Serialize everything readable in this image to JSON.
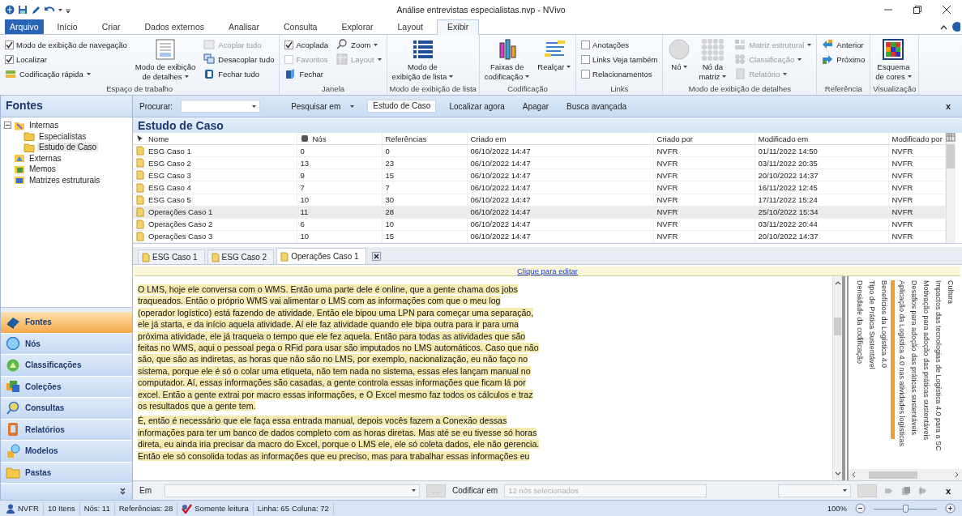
{
  "window": {
    "title": "Análise entrevistas especialistas.nvp - NVivo"
  },
  "ribbon_tabs": [
    {
      "label": "Arquivo",
      "kind": "file",
      "selected": false
    },
    {
      "label": "Início",
      "kind": "tab",
      "selected": false
    },
    {
      "label": "Criar",
      "kind": "tab",
      "selected": false
    },
    {
      "label": "Dados externos",
      "kind": "tab",
      "selected": false
    },
    {
      "label": "Analisar",
      "kind": "tab",
      "selected": false
    },
    {
      "label": "Consulta",
      "kind": "tab",
      "selected": false
    },
    {
      "label": "Explorar",
      "kind": "tab",
      "selected": false
    },
    {
      "label": "Layout",
      "kind": "tab",
      "selected": false
    },
    {
      "label": "Exibir",
      "kind": "tab",
      "selected": true
    }
  ],
  "ribbon_groups": [
    {
      "label": "Espaço de trabalho",
      "columns": [
        [
          {
            "kind": "check",
            "label": "Modo de exibição de navegação",
            "checked": true,
            "disabled": false
          },
          {
            "kind": "check",
            "label": "Localizar",
            "checked": true,
            "disabled": false
          },
          {
            "kind": "small",
            "label": "Codificação rápida",
            "disabled": false,
            "dropdown": true
          }
        ],
        [
          {
            "kind": "large",
            "label": "Modo de exibição\nde detalhes",
            "disabled": false,
            "dropdown": true
          }
        ],
        [
          {
            "kind": "small",
            "label": "Acoplar tudo",
            "disabled": true,
            "dropdown": false
          },
          {
            "kind": "small",
            "label": "Desacoplar tudo",
            "disabled": false,
            "dropdown": false
          },
          {
            "kind": "small",
            "label": "Fechar tudo",
            "disabled": false,
            "dropdown": false
          }
        ]
      ]
    },
    {
      "label": "Janela",
      "columns": [
        [
          {
            "kind": "check",
            "label": "Acoplada",
            "checked": true,
            "disabled": false
          },
          {
            "kind": "check",
            "label": "Favoritos",
            "checked": false,
            "disabled": true
          },
          {
            "kind": "small",
            "label": "Fechar",
            "disabled": false,
            "dropdown": false
          }
        ],
        [
          {
            "kind": "small",
            "label": "Zoom",
            "disabled": false,
            "dropdown": true
          },
          {
            "kind": "small",
            "label": "Layout",
            "disabled": true,
            "dropdown": true
          }
        ]
      ]
    },
    {
      "label": "Modo de exibição de lista",
      "columns": [
        [
          {
            "kind": "large",
            "label": "Modo de\nexibição de lista",
            "disabled": false,
            "dropdown": true
          }
        ]
      ]
    },
    {
      "label": "Codificação",
      "columns": [
        [
          {
            "kind": "large",
            "label": "Faixas de\ncodificação",
            "disabled": false,
            "dropdown": true
          }
        ],
        [
          {
            "kind": "large",
            "label": "Realçar",
            "disabled": false,
            "dropdown": true
          }
        ]
      ]
    },
    {
      "label": "Links",
      "columns": [
        [
          {
            "kind": "check",
            "label": "Anotações",
            "checked": false,
            "disabled": false
          },
          {
            "kind": "check",
            "label": "Links Veja também",
            "checked": false,
            "disabled": false
          },
          {
            "kind": "check",
            "label": "Relacionamentos",
            "checked": false,
            "disabled": false
          }
        ]
      ]
    },
    {
      "label": "Modo de exibição de detalhes",
      "columns": [
        [
          {
            "kind": "large",
            "label": "Nó",
            "disabled": true,
            "dropdown": true
          }
        ],
        [
          {
            "kind": "large",
            "label": "Nó da\nmatriz",
            "disabled": true,
            "dropdown": true
          }
        ],
        [
          {
            "kind": "small",
            "label": "Matriz estrutural",
            "disabled": true,
            "dropdown": true
          },
          {
            "kind": "small",
            "label": "Classificação",
            "disabled": true,
            "dropdown": true
          },
          {
            "kind": "small",
            "label": "Relatório",
            "disabled": true,
            "dropdown": true
          }
        ]
      ]
    },
    {
      "label": "Referência",
      "columns": [
        [
          {
            "kind": "small",
            "label": "Anterior",
            "disabled": false,
            "dropdown": false
          },
          {
            "kind": "small",
            "label": "Próximo",
            "disabled": false,
            "dropdown": false
          }
        ]
      ]
    },
    {
      "label": "Visualização",
      "columns": [
        [
          {
            "kind": "large",
            "label": "Esquema\nde cores",
            "disabled": false,
            "dropdown": true
          }
        ]
      ]
    }
  ],
  "sidebar": {
    "title": "Fontes",
    "tree": [
      {
        "label": "Internas",
        "expanded": true,
        "selected": false,
        "children": [
          {
            "label": "Especialistas",
            "selected": false
          },
          {
            "label": "Estudo de Caso",
            "selected": true
          }
        ]
      },
      {
        "label": "Externas",
        "selected": false
      },
      {
        "label": "Memos",
        "selected": false
      },
      {
        "label": "Matrizes estruturais",
        "selected": false
      }
    ],
    "nav": [
      {
        "label": "Fontes",
        "selected": true
      },
      {
        "label": "Nós",
        "selected": false
      },
      {
        "label": "Classificações",
        "selected": false
      },
      {
        "label": "Coleções",
        "selected": false
      },
      {
        "label": "Consultas",
        "selected": false
      },
      {
        "label": "Relatórios",
        "selected": false
      },
      {
        "label": "Modelos",
        "selected": false
      },
      {
        "label": "Pastas",
        "selected": false
      }
    ]
  },
  "find_bar": {
    "label": "Procurar:",
    "search_in_label": "Pesquisar em",
    "search_in_value": "Estudo de Caso",
    "find_now": "Localizar agora",
    "clear": "Apagar",
    "advanced": "Busca avançada",
    "close": "x"
  },
  "list": {
    "title": "Estudo de Caso",
    "columns": [
      "Nome",
      "Nós",
      "Referências",
      "Criado em",
      "Criado por",
      "Modificado em",
      "Modificado por"
    ],
    "rows": [
      {
        "selected": false,
        "cells": [
          "ESG Caso 1",
          "0",
          "0",
          "06/10/2022 14:47",
          "NVFR",
          "01/11/2022 14:50",
          "NVFR"
        ]
      },
      {
        "selected": false,
        "cells": [
          "ESG Caso 2",
          "13",
          "23",
          "06/10/2022 14:47",
          "NVFR",
          "03/11/2022 20:35",
          "NVFR"
        ]
      },
      {
        "selected": false,
        "cells": [
          "ESG Caso 3",
          "9",
          "15",
          "06/10/2022 14:47",
          "NVFR",
          "20/10/2022 14:37",
          "NVFR"
        ]
      },
      {
        "selected": false,
        "cells": [
          "ESG Caso 4",
          "7",
          "7",
          "06/10/2022 14:47",
          "NVFR",
          "16/11/2022 12:45",
          "NVFR"
        ]
      },
      {
        "selected": false,
        "cells": [
          "ESG Caso 5",
          "10",
          "30",
          "06/10/2022 14:47",
          "NVFR",
          "17/11/2022 15:24",
          "NVFR"
        ]
      },
      {
        "selected": true,
        "cells": [
          "Operações Caso 1",
          "11",
          "28",
          "06/10/2022 14:47",
          "NVFR",
          "25/10/2022 15:34",
          "NVFR"
        ]
      },
      {
        "selected": false,
        "cells": [
          "Operações Caso 2",
          "6",
          "10",
          "06/10/2022 14:47",
          "NVFR",
          "03/11/2022 20:44",
          "NVFR"
        ]
      },
      {
        "selected": false,
        "cells": [
          "Operações Caso 3",
          "10",
          "15",
          "06/10/2022 14:47",
          "NVFR",
          "20/10/2022 14:37",
          "NVFR"
        ]
      }
    ]
  },
  "document_tabs": [
    {
      "label": "ESG Caso 1",
      "selected": false
    },
    {
      "label": "ESG Caso 2",
      "selected": false
    },
    {
      "label": "Operações Caso 1",
      "selected": true
    }
  ],
  "document": {
    "edit_link": "Clique para editar",
    "paragraphs": [
      {
        "highlighted": true,
        "lines": [
          "O LMS, hoje ele conversa com o WMS. Então uma parte dele é online, que a gente chama dos jobs",
          "traqueados. Então o próprio WMS vai alimentar o LMS com as informações com que o meu log",
          "(operador logístico) está fazendo de atividade. Então ele bipou uma LPN para começar uma separação,",
          "ele já starta, e da início aquela atividade. Aí ele faz atividade quando ele bipa outra para ir para uma",
          "próxima atividade, ele já traqueia o tempo que ele fez aquela. Então para todas as atividades que são",
          "feitas no WMS, aqui o pessoal pega o RFid para usar são imputados no LMS automáticos. Caso que não",
          "são, que são as indiretas, as horas que não são no LMS, por exemplo, nacionalização, eu não faço no",
          "sistema, porque ele é só o colar uma etiqueta, não tem nada no sistema, essas eles lançam manual no",
          "computador. Aí, essas informações são casadas, a gente controla essas informações que ficam lá por",
          "excel. Então a gente extrai por macro essas informações, e O Excel mesmo faz todos os cálculos e traz",
          "os resultados que a gente tem."
        ]
      },
      {
        "highlighted": true,
        "lines": [
          "É, então é necessário que ele faça essa entrada manual, depois vocês fazem a Conexão dessas",
          "informações para ter um banco de dados completo com as horas diretas. Mas até se eu tivesse só horas",
          "direta, eu ainda iria precisar da macro do Excel, porque o LMS ele, ele só coleta dados, ele não gerencia.",
          "Então ele só consolida todas as informações que eu preciso, mas para trabalhar essas informações eu"
        ]
      }
    ],
    "coding_stripes": [
      {
        "label": "Densidade da codificação"
      },
      {
        "label": "Tipo de Prática Sustentável"
      },
      {
        "label": "Benefícios da Logística 4.0"
      },
      {
        "label": "Aplicação da Logística 4.0 nas atividades logísticas",
        "color": "#f0a030"
      },
      {
        "label": "Desafios para adoção das práticas sustentáveis"
      },
      {
        "label": "Motivação para adoção das práticas sustentáveis"
      },
      {
        "label": "Impactos das tecnologias de Logística 4.0 para a SC"
      },
      {
        "label": "Cultura"
      }
    ]
  },
  "code_bar": {
    "in_label": "Em",
    "browse": "...",
    "code_in_label": "Codificar em",
    "nodes_placeholder": "12 nós selecionados",
    "close": "x"
  },
  "status_bar": {
    "user": "NVFR",
    "items": [
      "10 Itens",
      "Nós: 11",
      "Referências: 28"
    ],
    "read_only": "Somente leitura",
    "position": [
      "Linha: 65",
      "Coluna: 72"
    ],
    "zoom": "100%",
    "zoom_slider": {
      "level": 0.5
    }
  }
}
